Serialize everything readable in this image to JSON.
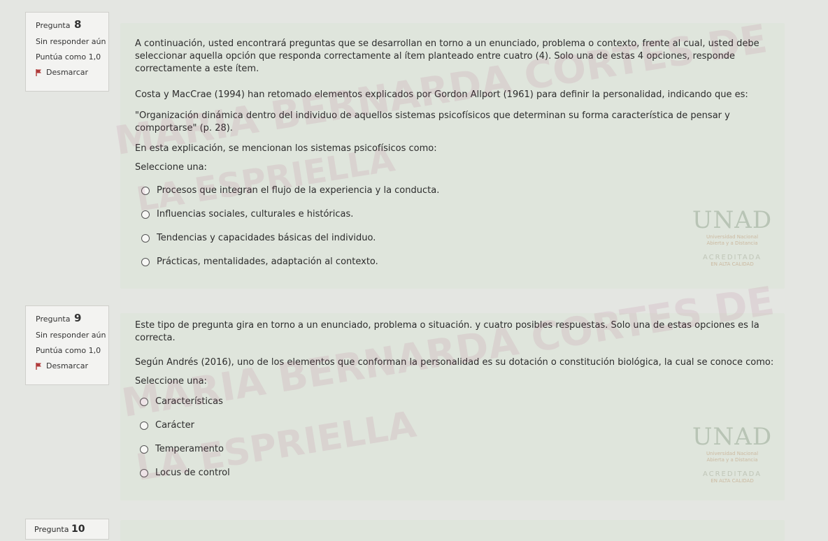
{
  "questions": [
    {
      "label": "Pregunta",
      "number": "8",
      "status": "Sin responder aún",
      "points": "Puntúa como 1,0",
      "flag": "Desmarcar",
      "paragraphs": [
        "A continuación, usted encontrará preguntas que se desarrollan en torno a un enunciado, problema o contexto, frente al cual, usted debe seleccionar aquella opción que responda correctamente al ítem planteado entre cuatro (4). Solo una de estas 4 opciones, responde correctamente a este ítem.",
        "Costa y MacCrae (1994) han retomado elementos explicados por Gordon Allport (1961) para definir la personalidad, indicando que es:",
        "\"Organización dinámica dentro del individuo de aquellos sistemas psicofísicos que determinan su forma característica de pensar y comportarse\" (p. 28).",
        "En esta explicación, se mencionan los sistemas psicofísicos como:"
      ],
      "prompt": "Seleccione una:",
      "options": [
        "Procesos que integran el flujo de la experiencia y la conducta.",
        "Influencias sociales, culturales e históricas.",
        "Tendencias y capacidades básicas del individuo.",
        "Prácticas, mentalidades, adaptación al contexto."
      ]
    },
    {
      "label": "Pregunta",
      "number": "9",
      "status": "Sin responder aún",
      "points": "Puntúa como 1,0",
      "flag": "Desmarcar",
      "paragraphs": [
        "Este tipo de pregunta gira en torno a un enunciado, problema o situación. y cuatro posibles respuestas. Solo una de estas opciones es la correcta.",
        "Según Andrés (2016), uno de los elementos que conforman la personalidad es su dotación o constitución biológica, la cual se conoce como:"
      ],
      "prompt": "Seleccione una:",
      "options": [
        "Características",
        "Carácter",
        "Temperamento",
        "Locus de control"
      ]
    }
  ],
  "next_question": {
    "label": "Pregunta",
    "number": "10"
  },
  "logo": {
    "word": "UNAD",
    "subtitle_1": "Universidad Nacional",
    "subtitle_2": "Abierta y a Distancia",
    "accreditation": "ACREDITADA",
    "accreditation_sub": "EN ALTA CALIDAD"
  },
  "watermark": {
    "line_1": "MARIA BERNARDA CORTES DE",
    "line_2": "LA ESPRIELLA"
  },
  "colors": {
    "flag": "#b03a3a",
    "panel": "#dfe5dc",
    "info_box": "#f3f3f1"
  }
}
